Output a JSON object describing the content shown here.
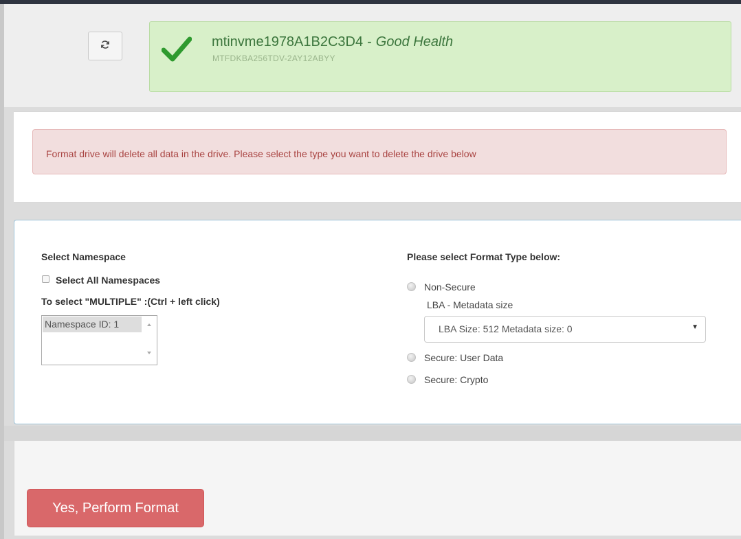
{
  "drive": {
    "name": "mtinvme1978A1B2C3D4",
    "separator": "-",
    "health": "Good Health",
    "model": "MTFDKBA256TDV-2AY12ABYY"
  },
  "alert": {
    "message": "Format drive will delete all data in the drive. Please select the type you want to delete the drive below"
  },
  "namespace": {
    "heading": "Select Namespace",
    "select_all_label": "Select All Namespaces",
    "multi_hint": "To select \"MULTIPLE\" :(Ctrl + left click)",
    "options": [
      "Namespace ID: 1"
    ]
  },
  "format_type": {
    "heading": "Please select Format Type below:",
    "non_secure_label": "Non-Secure",
    "lba_label": "LBA - Metadata size",
    "lba_selected": "LBA Size: 512 Metadata size: 0",
    "secure_user_label": "Secure: User Data",
    "secure_crypto_label": "Secure: Crypto"
  },
  "actions": {
    "perform_label": "Yes, Perform Format"
  },
  "icons": {
    "refresh": "refresh-icon",
    "check": "checkmark-icon",
    "dropdown": "caret-down-icon"
  },
  "colors": {
    "success_bg": "#d8f0c9",
    "success_text": "#3c763d",
    "danger_bg": "#f2dede",
    "danger_text": "#a94442",
    "button_bg": "#d9686a"
  }
}
